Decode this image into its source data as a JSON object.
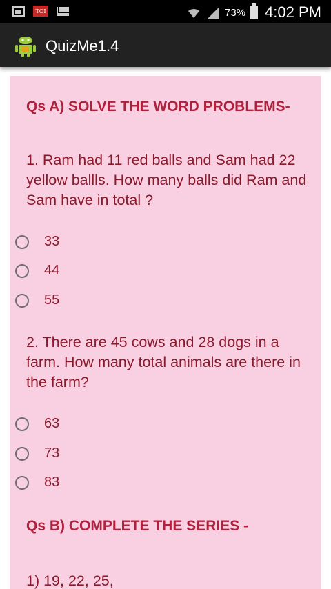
{
  "status_bar": {
    "battery_percent": "73%",
    "time": "4:02 PM",
    "toi_label": "TOI",
    "icons": [
      "image-icon",
      "toi-icon",
      "mail-icon",
      "wifi-icon",
      "signal-icon",
      "battery-icon"
    ]
  },
  "action_bar": {
    "title": "QuizMe1.4",
    "logo_icon": "android-icon"
  },
  "content": {
    "background": "#f9cfe2",
    "section_a_title": "Qs A) SOLVE THE WORD PROBLEMS-",
    "questions": [
      {
        "text": "1. Ram had 11 red balls and Sam had 22 yellow ballls. How many balls did Ram and Sam have in total ?",
        "options": [
          "33",
          "44",
          "55"
        ]
      },
      {
        "text": "2. There are 45 cows and 28 dogs in a farm. How many total animals are there in the farm?",
        "options": [
          "63",
          "73",
          "83"
        ]
      }
    ],
    "section_b_title": "Qs B) COMPLETE THE SERIES -",
    "series_partial": "1) 19, 22, 25,"
  }
}
